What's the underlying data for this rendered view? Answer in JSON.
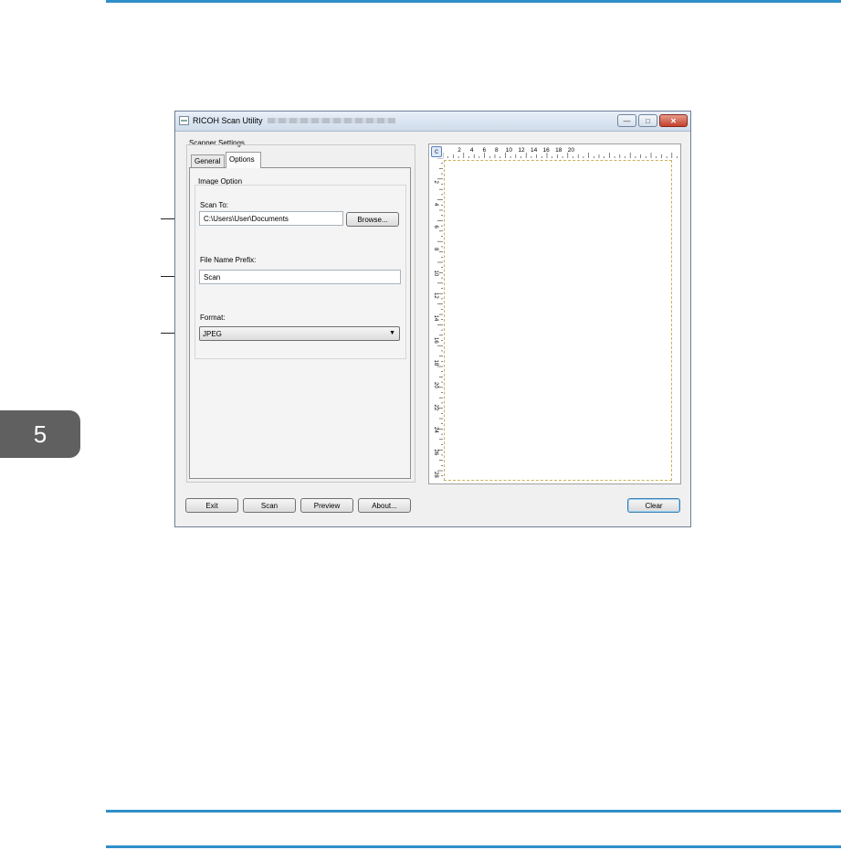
{
  "chapter": {
    "number": "5"
  },
  "window": {
    "title": "RICOH Scan Utility",
    "controls": {
      "minimize": "—",
      "maximize": "□",
      "close": "✕"
    }
  },
  "settings": {
    "group_label": "Scanner Settings",
    "tabs": [
      {
        "label": "General"
      },
      {
        "label": "Options",
        "selected": true
      }
    ],
    "image_option": {
      "heading": "Image Option",
      "scan_to": {
        "label": "Scan To:",
        "value": "C:\\Users\\User\\Documents",
        "browse_label": "Browse..."
      },
      "prefix": {
        "label": "File Name Prefix:",
        "value": "Scan"
      },
      "format": {
        "label": "Format:",
        "value": "JPEG"
      }
    }
  },
  "preview": {
    "ruler_top_labels": [
      "2",
      "4",
      "6",
      "8",
      "10",
      "12",
      "14",
      "16",
      "18",
      "20"
    ],
    "ruler_left_labels": [
      "2",
      "4",
      "6",
      "8",
      "10",
      "12",
      "14",
      "16",
      "18",
      "20",
      "22",
      "24",
      "26",
      "28"
    ]
  },
  "buttons": {
    "exit": "Exit",
    "scan": "Scan",
    "preview": "Preview",
    "about": "About...",
    "clear": "Clear"
  },
  "colors": {
    "rule": "#2f8fc8",
    "chapter_tab": "#606060"
  }
}
